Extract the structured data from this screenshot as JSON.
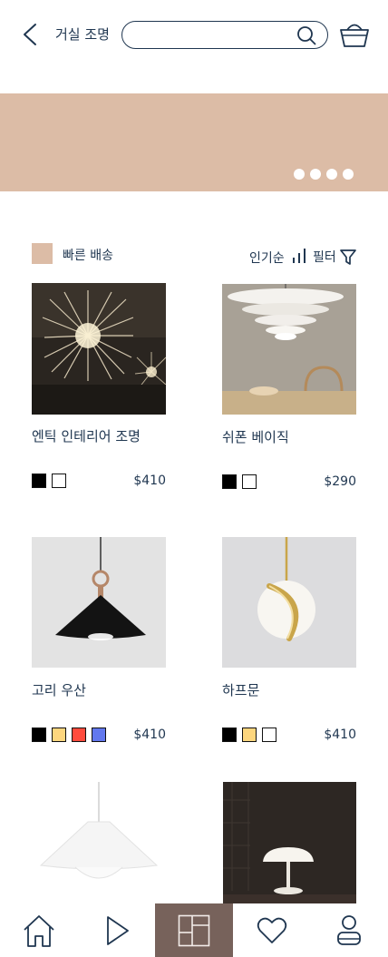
{
  "header": {
    "title": "거실 조명",
    "search_value": "",
    "search_placeholder": ""
  },
  "banner": {
    "color": "#dcbca6",
    "dot_count": 4
  },
  "filters": {
    "fast_delivery_label": "빠른 배송",
    "fast_delivery_color": "#dcbca6",
    "sort_label": "인기순",
    "filter_label": "필터"
  },
  "products": [
    {
      "name": "엔틱 인테리어 조명",
      "price": "$410",
      "swatches": [
        "#000000",
        "#ffffff"
      ]
    },
    {
      "name": "쉬폰 베이직",
      "price": "$290",
      "swatches": [
        "#000000",
        "#ffffff"
      ]
    },
    {
      "name": "고리 우산",
      "price": "$410",
      "swatches": [
        "#000000",
        "#fdd67e",
        "#ff4b3d",
        "#6278ee"
      ]
    },
    {
      "name": "하프문",
      "price": "$410",
      "swatches": [
        "#000000",
        "#fdd67e",
        "#ffffff"
      ]
    },
    {
      "name": "",
      "price": "",
      "swatches": []
    },
    {
      "name": "",
      "price": "",
      "swatches": []
    }
  ],
  "nav": {
    "items": [
      "home-icon",
      "play-icon",
      "category-icon",
      "heart-icon",
      "user-icon"
    ],
    "active_index": 2,
    "active_color": "#77625b"
  }
}
